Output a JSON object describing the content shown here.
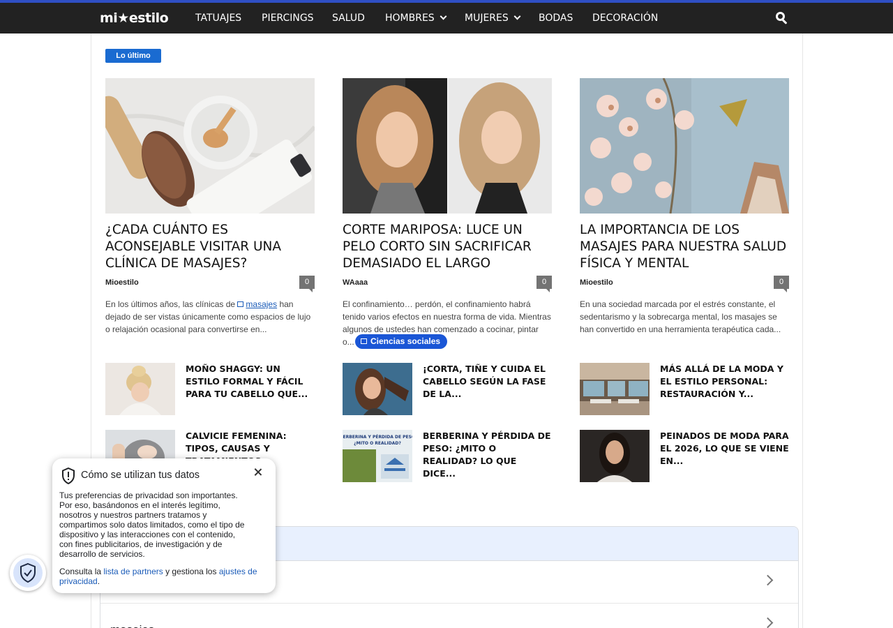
{
  "site": {
    "logo": "mi★estilo",
    "accent": "#1a6bd1"
  },
  "nav": {
    "items": [
      {
        "label": "TATUAJES",
        "dropdown": false
      },
      {
        "label": "PIERCINGS",
        "dropdown": false
      },
      {
        "label": "SALUD",
        "dropdown": false
      },
      {
        "label": "HOMBRES",
        "dropdown": true
      },
      {
        "label": "MUJERES",
        "dropdown": true
      },
      {
        "label": "BODAS",
        "dropdown": false
      },
      {
        "label": "DECORACIÓN",
        "dropdown": false
      }
    ],
    "search_icon": "search-icon"
  },
  "section_tag": "Lo último",
  "featured": [
    {
      "title": "¿CADA CUÁNTO ES ACONSEJABLE VISITAR UNA CLÍNICA DE MASAJES?",
      "author": "Mioestilo",
      "comments": "0",
      "excerpt_before": "En los últimos años, las clínicas de ",
      "excerpt_keyword": "masajes",
      "excerpt_after": " han dejado de ser vistas únicamente como espacios de lujo o relajación ocasional para convertirse en..."
    },
    {
      "title": "CORTE MARIPOSA: LUCE UN PELO CORTO SIN SACRIFICAR DEMASIADO EL LARGO",
      "author": "WAaaa",
      "comments": "0",
      "excerpt": "El confinamiento… perdón, el confinamiento habrá tenido varios efectos en nuestra forma de vida. Mientras algunos de ustedes han comenzado a cocinar, pintar o...",
      "pill": "Ciencias sociales"
    },
    {
      "title": "LA IMPORTANCIA DE LOS MASAJES PARA NUESTRA SALUD FÍSICA Y MENTAL",
      "author": "Mioestilo",
      "comments": "0",
      "excerpt": "En una sociedad marcada por el estrés constante, el sedentarismo y la sobrecarga mental, los masajes se han convertido en una herramienta terapéutica cada..."
    }
  ],
  "mini_posts": [
    {
      "title": "MOÑO SHAGGY: UN ESTILO FORMAL Y FÁCIL PARA TU CABELLO QUE..."
    },
    {
      "title": "¡CORTA, TIÑE Y CUIDA EL CABELLO SEGÚN LA FASE DE LA..."
    },
    {
      "title": "MÁS ALLÁ DE LA MODA Y EL ESTILO PERSONAL: RESTAURACIÓN Y..."
    },
    {
      "title": "CALVICIE FEMENINA: TIPOS, CAUSAS Y TRATAMIENTOS"
    },
    {
      "title": "BERBERINA Y PÉRDIDA DE PESO: ¿MITO O REALIDAD? LO QUE DICE..."
    },
    {
      "title": "PEINADOS DE MODA PARA EL 2026, LO QUE SE VIENE EN..."
    }
  ],
  "mini_thumb_texts": {
    "berberina": "BERBERINA Y PÉRDIDA DE PESO ¿MITO O REALIDAD?"
  },
  "related_panel": {
    "rows": [
      {
        "label": ""
      },
      {
        "label": "masajes"
      }
    ]
  },
  "privacy_popup": {
    "title": "Cómo se utilizan tus datos",
    "body": "Tus preferencias de privacidad son importantes. Por eso, basándonos en el interés legítimo, nosotros y nuestros partners tratamos y compartimos solo datos limitados, como el tipo de dispositivo y las interacciones con el contenido, con fines publicitarios, de investigación y de desarrollo de servicios.",
    "foot_prefix": "Consulta la ",
    "partners_link": "lista de partners",
    "foot_middle": " y gestiona los ",
    "settings_link": "ajustes de privacidad",
    "foot_suffix": "."
  }
}
